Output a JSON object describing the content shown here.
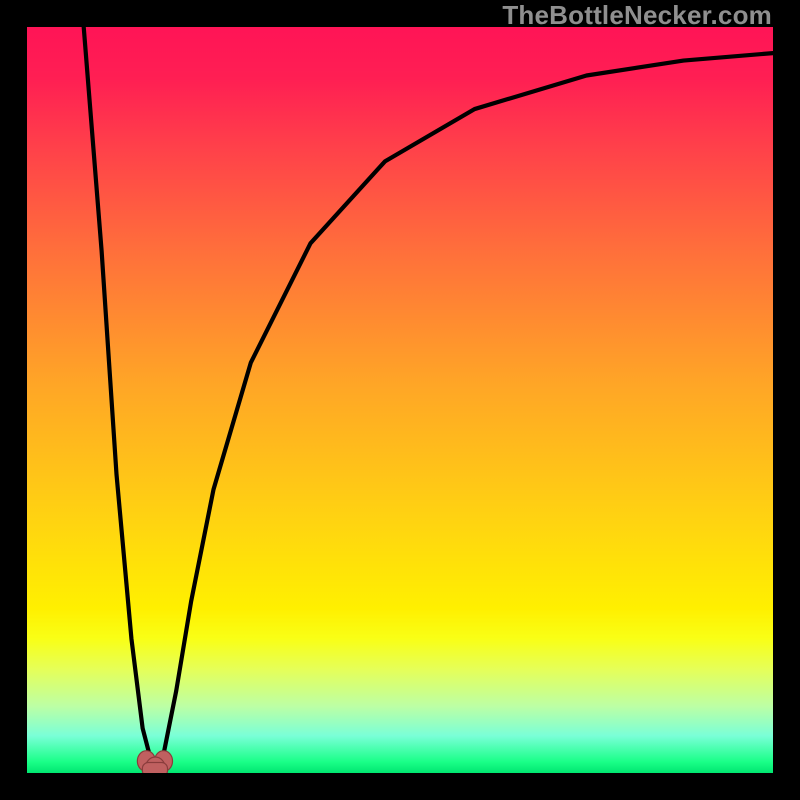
{
  "watermark": {
    "text": "TheBottleNecker.com"
  },
  "chart_data": {
    "type": "line",
    "title": "",
    "xlabel": "",
    "ylabel": "",
    "xlim": [
      0,
      100
    ],
    "ylim": [
      0,
      100
    ],
    "background": "red-to-green-vertical-gradient",
    "note": "V-shaped bottleneck curve; minimum near x≈17. Axis values are estimated from pixel positions (no numeric ticks shown).",
    "series": [
      {
        "name": "bottleneck-curve",
        "x": [
          7.6,
          10,
          12,
          14,
          15.5,
          16.8,
          18.2,
          20,
          22,
          25,
          30,
          38,
          48,
          60,
          75,
          88,
          100
        ],
        "values": [
          100,
          70,
          40,
          18,
          6,
          1,
          2,
          11,
          23,
          38,
          55,
          71,
          82,
          89,
          93.5,
          95.5,
          96.5
        ]
      }
    ],
    "markers": [
      {
        "name": "min-marker-left",
        "x": 16.0,
        "y": 1.6
      },
      {
        "name": "min-marker-right",
        "x": 18.3,
        "y": 1.6
      },
      {
        "name": "min-marker-base",
        "x": 17.2,
        "y": 0.6
      }
    ]
  }
}
